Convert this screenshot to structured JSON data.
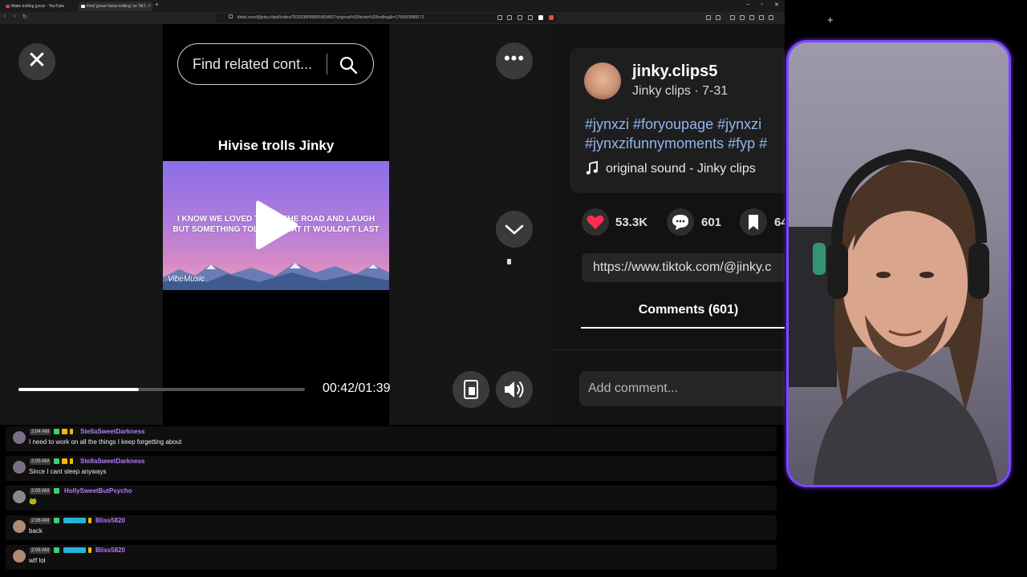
{
  "browser": {
    "tabs": [
      {
        "title": "Make trolling jynxzi - YouTube",
        "favicon_color": "#e53935"
      },
      {
        "title": "Find 'jynxzi hivise trolling' on TikT...",
        "favicon_color": "#ffffff"
      }
    ],
    "new_tab": "+",
    "url": "tiktok.com/@jinky.clips5/video/7533338099665583491?q=jynxzi%20hivise%20trolling&t=1756533889173",
    "window_controls": [
      "–",
      "▫",
      "✕"
    ]
  },
  "video": {
    "close_label": "✕",
    "search_placeholder": "Find related cont...",
    "more_label": "•••",
    "title": "Hivise trolls Jinky",
    "lyrics_line1": "I KNOW WE LOVED TO HIT THE ROAD AND LAUGH",
    "lyrics_line2": "BUT SOMETHING TOLD ME THAT IT WOULDN'T LAST",
    "watermark": "VibeMusic",
    "time": "00:42/01:39",
    "progress_fraction": 0.42
  },
  "panel": {
    "username": "jinky.clips5",
    "subinfo": "Jinky clips · 7-31",
    "hashtags_line1": "#jynxzi #foryoupage #jynxzi",
    "hashtags_line2": "#jynxzifunnymoments #fyp #",
    "sound": "original sound - Jinky clips",
    "likes": "53.3K",
    "comments": "601",
    "saves": "64",
    "link": "https://www.tiktok.com/@jinky.c",
    "comments_tab": "Comments (601)",
    "comment_placeholder": "Add comment...",
    "colors": {
      "like": "#fe2c55",
      "hashtag": "#8fb6ee"
    }
  },
  "chat": {
    "messages": [
      {
        "time": "2:04 AM",
        "user": "StellaSweetDarkness",
        "text": "I need to work on all the things I keep forgetting about"
      },
      {
        "time": "2:05 AM",
        "user": "StellaSweetDarkness",
        "text": "Since I cant sleep anyways"
      },
      {
        "time": "2:05 AM",
        "user": "HollySweetButPsycho",
        "text": "🐸"
      },
      {
        "time": "2:06 AM",
        "user": "Bliss5820",
        "text": "back"
      },
      {
        "time": "2:06 AM",
        "user": "Bliss5820",
        "text": "wtf lol"
      }
    ],
    "username_color": "#b77cff"
  },
  "webcam": {
    "add_label": "+",
    "border_color": "#7f46ff"
  }
}
